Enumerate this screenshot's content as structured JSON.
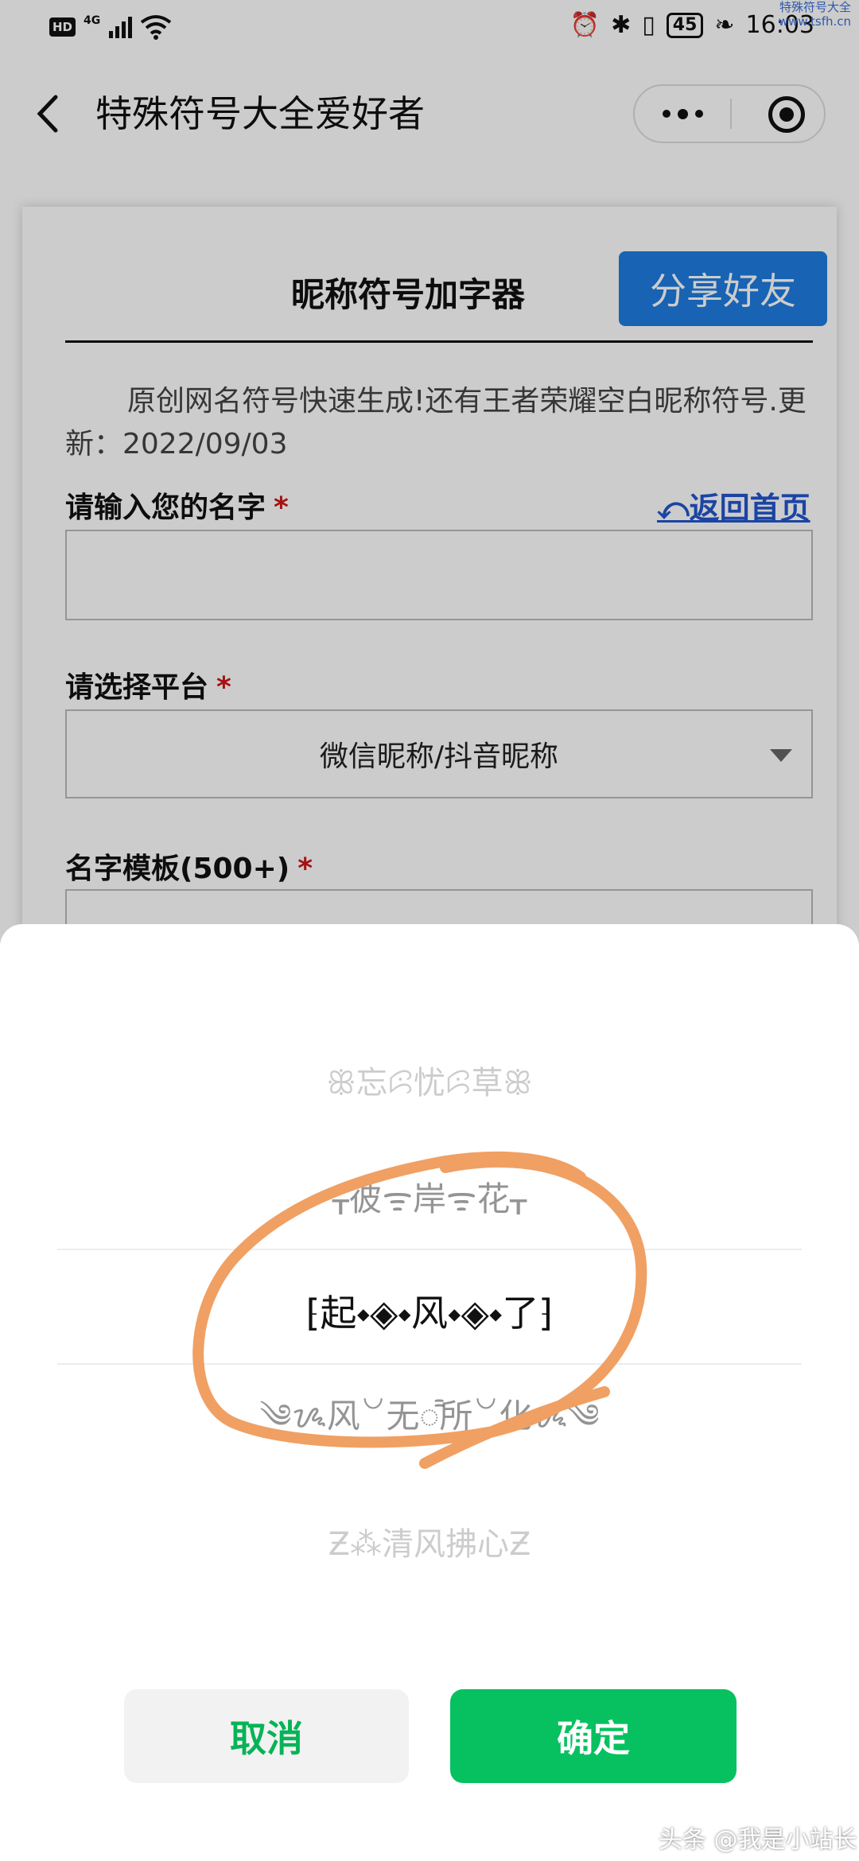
{
  "status_bar": {
    "hd_badge": "HD",
    "network": "4G",
    "battery": "45",
    "time": "16:03",
    "watermark_top": "特殊符号大全 www.tsfh.cn"
  },
  "nav": {
    "title": "特殊符号大全爱好者"
  },
  "card": {
    "title": "昵称符号加字器",
    "share_label": "分享好友",
    "intro": "原创网名符号快速生成!还有王者荣耀空白昵称符号.更新：2022/09/03",
    "name_label": "请输入您的名字",
    "required_mark": "*",
    "home_link": "⤺返回首页",
    "name_value": "",
    "platform_label": "请选择平台",
    "platform_value": "微信昵称/抖音昵称",
    "template_label": "名字模板(500+)"
  },
  "picker": {
    "items": [
      "ꕥ忘ꕸ忧ꕸ草ꕥ",
      "ᚁ彼ᯤ岸ᯤ花ᚁ",
      "⁅起⬩◈⬩风⬩◈⬩了⁆",
      "༄ᝰ风꒡无ᯱ所꒡化ᝰ༄",
      "Ƶ⁂清风拂心Ƶ"
    ],
    "cancel_label": "取消",
    "confirm_label": "确定"
  },
  "colors": {
    "accent_green": "#07c160",
    "share_blue": "#1f7ce0",
    "annotation_orange": "#f0a063"
  },
  "watermark_bottom": "头条 @我是小站长"
}
